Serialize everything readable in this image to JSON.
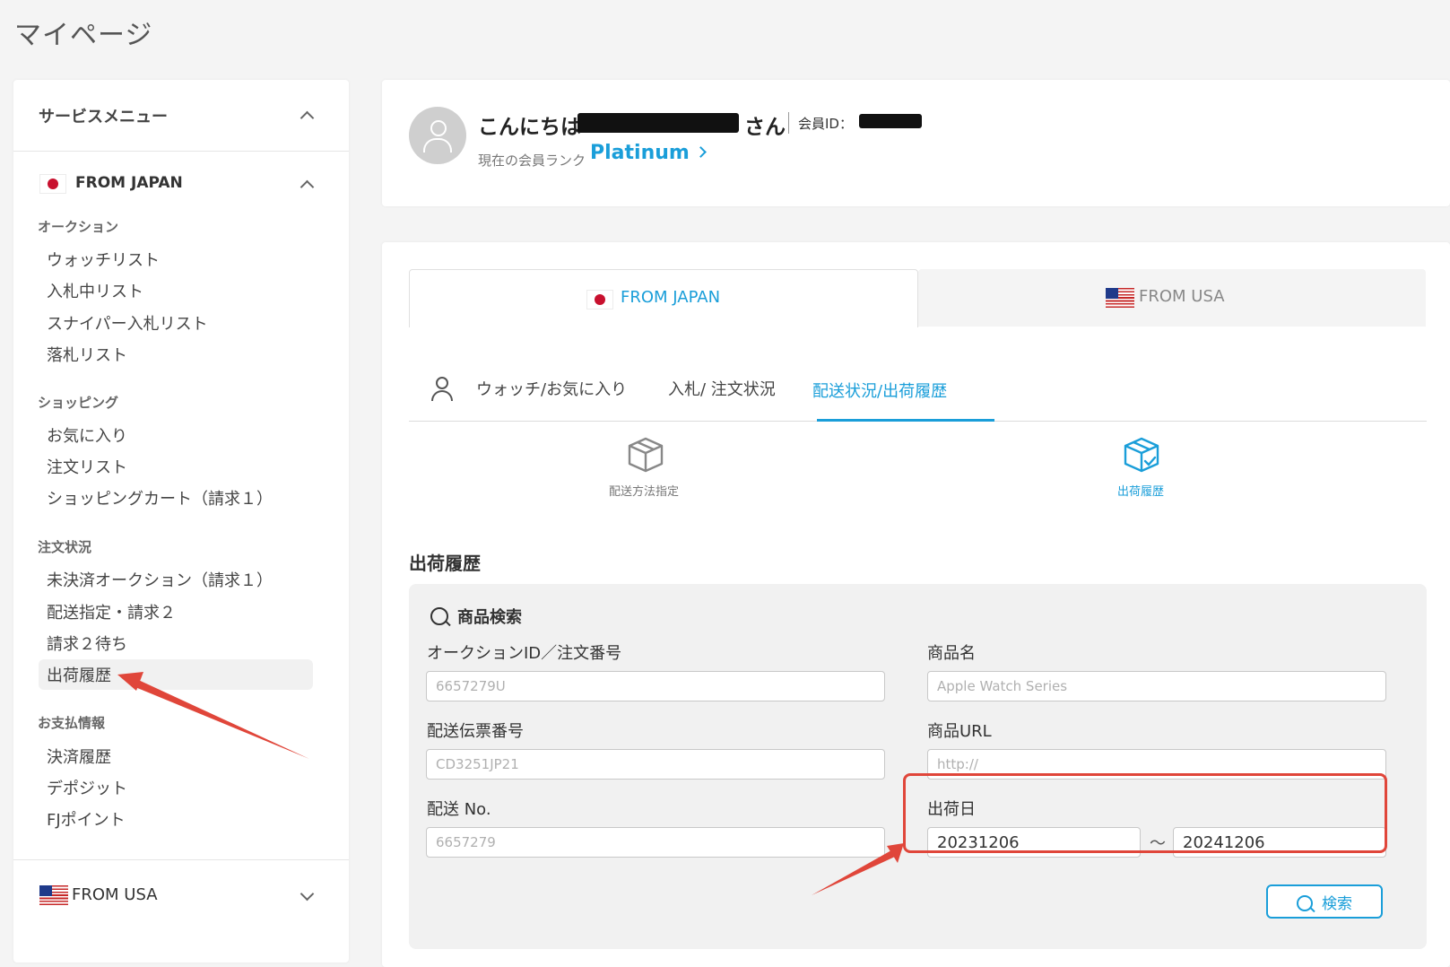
{
  "page": {
    "title": "マイページ"
  },
  "sidebar": {
    "header": "サービスメニュー",
    "from_japan": {
      "label": "FROM JAPAN",
      "sections": [
        {
          "title": "オークション",
          "items": [
            "ウォッチリスト",
            "入札中リスト",
            "スナイパー入札リスト",
            "落札リスト"
          ]
        },
        {
          "title": "ショッピング",
          "items": [
            "お気に入り",
            "注文リスト",
            "ショッピングカート（請求１）"
          ]
        },
        {
          "title": "注文状況",
          "items": [
            "未決済オークション（請求１）",
            "配送指定・請求２",
            "請求２待ち",
            "出荷履歴"
          ]
        },
        {
          "title": "お支払情報",
          "items": [
            "決済履歴",
            "デポジット",
            "FJポイント"
          ]
        }
      ],
      "active_item": "出荷履歴"
    },
    "from_usa": {
      "label": "FROM USA"
    }
  },
  "profile": {
    "greeting_prefix": "こんにちは",
    "greeting_suffix": "さん",
    "member_id_label": "会員ID：",
    "rank_label": "現在の会員ランク",
    "rank_value": "Platinum"
  },
  "region_tabs": [
    {
      "label": "FROM JAPAN",
      "active": true
    },
    {
      "label": "FROM USA",
      "active": false
    }
  ],
  "sub_tabs": [
    {
      "label": "ウォッチ/お気に入り",
      "active": false
    },
    {
      "label": "入札/ 注文状況",
      "active": false
    },
    {
      "label": "配送状況/出荷履歴",
      "active": true
    }
  ],
  "shipping_options": [
    {
      "label": "配送方法指定",
      "icon": "box-icon",
      "active": false
    },
    {
      "label": "出荷履歴",
      "icon": "box-check-icon",
      "active": true
    }
  ],
  "section_title": "出荷履歴",
  "search": {
    "heading": "商品検索",
    "fields": {
      "auction_id": {
        "label": "オークションID／注文番号",
        "placeholder": "6657279U"
      },
      "product_name": {
        "label": "商品名",
        "placeholder": "Apple Watch Series"
      },
      "tracking_no": {
        "label": "配送伝票番号",
        "placeholder": "CD3251JP21"
      },
      "product_url": {
        "label": "商品URL",
        "placeholder": "http://"
      },
      "shipping_no": {
        "label": "配送 No.",
        "placeholder": "6657279"
      },
      "ship_date": {
        "label": "出荷日",
        "from": "20231206",
        "separator": "～",
        "to": "20241206"
      }
    },
    "button_label": "検索"
  },
  "colors": {
    "accent": "#1a9ed9",
    "annotation": "#e0463a"
  }
}
